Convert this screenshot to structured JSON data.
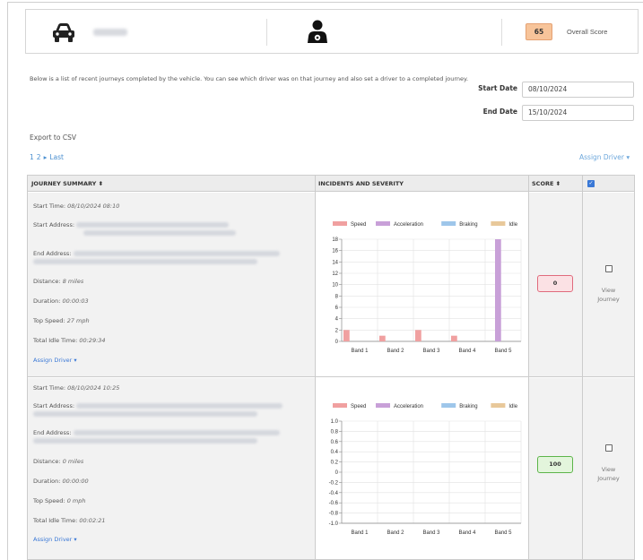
{
  "vehicle": {
    "score": "65",
    "score_label": "Overall Score"
  },
  "description": "Below is a list of recent journeys completed by the vehicle. You can see which driver was on that journey and also set a driver to a completed journey.",
  "filters": {
    "start_label": "Start Date",
    "start_value": "08/10/2024",
    "end_label": "End Date",
    "end_value": "15/10/2024"
  },
  "export_label": "Export to CSV",
  "pagination": {
    "page1": "1",
    "page2": "2",
    "next": "▸",
    "last": "Last"
  },
  "assign_driver_top": "Assign Driver ▾",
  "table": {
    "headers": {
      "summary": "JOURNEY SUMMARY ⬍",
      "incidents": "INCIDENTS AND SEVERITY",
      "score": "SCORE ⬍"
    }
  },
  "labels": {
    "start_time": "Start Time:",
    "start_address": "Start Address:",
    "end_address": "End Address:",
    "distance": "Distance:",
    "duration": "Duration:",
    "top_speed": "Top Speed:",
    "idle_time": "Total Idle Time:",
    "assign_driver": "Assign Driver ▾",
    "view_line1": "View",
    "view_line2": "Journey"
  },
  "legend": [
    {
      "name": "Speed",
      "color": "#f0a0a0"
    },
    {
      "name": "Acceleration",
      "color": "#c8a0d8"
    },
    {
      "name": "Braking",
      "color": "#9ec6ea"
    },
    {
      "name": "Idle",
      "color": "#e8c89a"
    }
  ],
  "journeys": [
    {
      "start_time": "08/10/2024 08:10",
      "distance": "8 miles",
      "duration": "00:00:03",
      "top_speed": "27 mph",
      "idle_time": "00:29:34",
      "score": "0",
      "score_color": "#e06b7d",
      "chart_data": {
        "type": "bar",
        "categories": [
          "Band 1",
          "Band 2",
          "Band 3",
          "Band 4",
          "Band 5"
        ],
        "series": [
          {
            "name": "Speed",
            "values": [
              2,
              1,
              2,
              1,
              0
            ]
          },
          {
            "name": "Acceleration",
            "values": [
              0,
              0,
              0,
              0,
              18
            ]
          },
          {
            "name": "Braking",
            "values": [
              0,
              0,
              0,
              0,
              0
            ]
          },
          {
            "name": "Idle",
            "values": [
              0,
              0,
              0,
              0,
              0
            ]
          }
        ],
        "ylim": [
          0,
          18
        ],
        "yticks": [
          "0",
          "2",
          "4",
          "6",
          "8",
          "10",
          "12",
          "14",
          "16",
          "18"
        ]
      }
    },
    {
      "start_time": "08/10/2024 10:25",
      "distance": "0 miles",
      "duration": "00:00:00",
      "top_speed": "0 mph",
      "idle_time": "00:02:21",
      "score": "100",
      "score_color": "#5db54a",
      "chart_data": {
        "type": "bar",
        "categories": [
          "Band 1",
          "Band 2",
          "Band 3",
          "Band 4",
          "Band 5"
        ],
        "series": [
          {
            "name": "Speed",
            "values": [
              0,
              0,
              0,
              0,
              0
            ]
          },
          {
            "name": "Acceleration",
            "values": [
              0,
              0,
              0,
              0,
              0
            ]
          },
          {
            "name": "Braking",
            "values": [
              0,
              0,
              0,
              0,
              0
            ]
          },
          {
            "name": "Idle",
            "values": [
              0,
              0,
              0,
              0,
              0
            ]
          }
        ],
        "ylim": [
          -1,
          1
        ],
        "yticks": [
          "-1.0",
          "-0.8",
          "-0.6",
          "-0.4",
          "-0.2",
          "0",
          "0.2",
          "0.4",
          "0.6",
          "0.8",
          "1.0"
        ]
      }
    }
  ]
}
